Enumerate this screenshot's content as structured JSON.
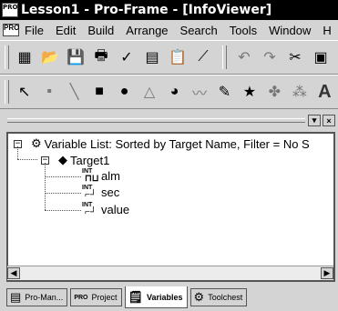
{
  "window": {
    "title": "Lesson1 - Pro-Frame - [InfoViewer]",
    "app_icon_text": "PRO",
    "sys_icon_text": "PRO"
  },
  "menu": [
    "File",
    "Edit",
    "Build",
    "Arrange",
    "Search",
    "Tools",
    "Window",
    "H"
  ],
  "toolbar1": [
    {
      "icon": "open-db-icon",
      "glyph": "▦"
    },
    {
      "icon": "open-folder-icon",
      "glyph": "📂"
    },
    {
      "icon": "save-icon",
      "glyph": "💾"
    },
    {
      "icon": "print-icon",
      "glyph": "🖶"
    },
    {
      "icon": "check-icon",
      "glyph": "✓"
    },
    {
      "icon": "calendar-icon",
      "glyph": "▤"
    },
    {
      "icon": "clipboard-icon",
      "glyph": "📋"
    },
    {
      "icon": "chart-icon",
      "glyph": "⟋"
    },
    {
      "icon": "undo-icon",
      "glyph": "↶"
    },
    {
      "icon": "redo-icon",
      "glyph": "↷"
    },
    {
      "icon": "cut-icon",
      "glyph": "✂"
    },
    {
      "icon": "paste-icon",
      "glyph": "▣"
    }
  ],
  "toolbar2": [
    {
      "icon": "pointer-icon",
      "glyph": "↖",
      "dim": false
    },
    {
      "icon": "dot-icon",
      "glyph": "▪",
      "dim": true
    },
    {
      "icon": "line-icon",
      "glyph": "╲",
      "dim": true
    },
    {
      "icon": "rectangle-icon",
      "glyph": "■",
      "dim": false
    },
    {
      "icon": "ellipse-icon",
      "glyph": "●",
      "dim": false
    },
    {
      "icon": "polygon-icon",
      "glyph": "△",
      "dim": true
    },
    {
      "icon": "pie-icon",
      "glyph": "◕",
      "dim": false
    },
    {
      "icon": "polyline-icon",
      "glyph": "〰",
      "dim": true
    },
    {
      "icon": "freehand-icon",
      "glyph": "✎",
      "dim": false
    },
    {
      "icon": "star-icon",
      "glyph": "★",
      "dim": false
    },
    {
      "icon": "shape-icon",
      "glyph": "✤",
      "dim": true
    },
    {
      "icon": "pattern-icon",
      "glyph": "⁂",
      "dim": true
    },
    {
      "icon": "text-icon",
      "glyph": "A",
      "dim": false
    }
  ],
  "panel": {
    "pin_label": "▾",
    "close_label": "×"
  },
  "tree": {
    "root_expander": "−",
    "root_label": "Variable List: Sorted by Target Name, Filter = No S",
    "target_expander": "−",
    "target_label": "Target1",
    "variables": [
      {
        "type": "INT",
        "name": "alm"
      },
      {
        "type": "INT",
        "name": "sec"
      },
      {
        "type": "INT",
        "name": "value"
      }
    ]
  },
  "tabs": [
    {
      "label": "Pro-Man...",
      "icon": "▤",
      "active": false
    },
    {
      "label": "Project",
      "icon": "PRO",
      "active": false
    },
    {
      "label": "Variables",
      "icon": "🗒",
      "active": true
    },
    {
      "label": "Toolchest",
      "icon": "⚙",
      "active": false
    }
  ]
}
